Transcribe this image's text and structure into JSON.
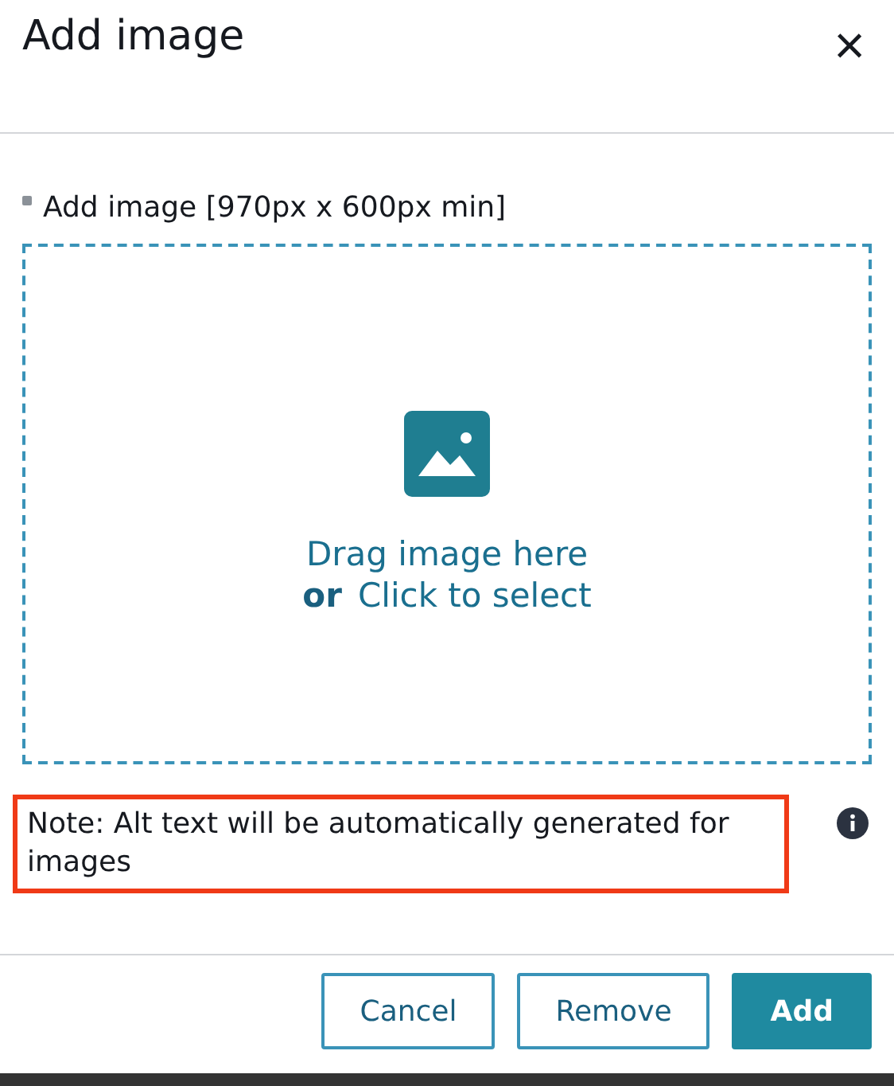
{
  "dialog": {
    "title": "Add image",
    "close": "×"
  },
  "upload": {
    "label": "Add image [970px x 600px min]",
    "required": true,
    "drop_text": "Drag image here",
    "or": "or",
    "select_link": "Click to select"
  },
  "note": {
    "text": "Note: Alt text will be automatically generated for images",
    "highlighted": true
  },
  "buttons": [
    {
      "label": "Cancel",
      "kind": "secondary"
    },
    {
      "label": "Remove",
      "kind": "secondary"
    },
    {
      "label": "Add",
      "kind": "primary"
    }
  ]
}
